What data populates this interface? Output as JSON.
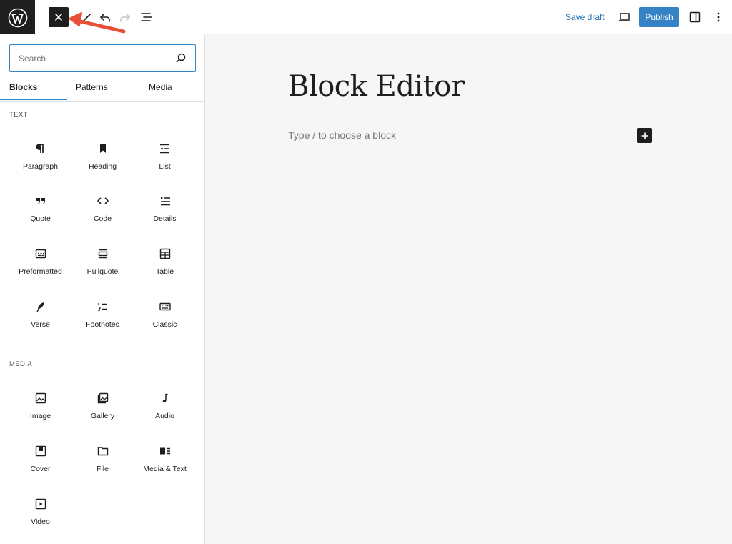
{
  "header": {
    "save_draft_label": "Save draft",
    "publish_label": "Publish",
    "icons": [
      "wordpress-logo-icon",
      "close-icon",
      "undo-icon",
      "redo-icon",
      "document-overview-icon",
      "preview-icon",
      "settings-icon",
      "more-options-icon"
    ]
  },
  "inserter": {
    "search_placeholder": "Search",
    "tabs": [
      "Blocks",
      "Patterns",
      "Media"
    ],
    "active_tab": "Blocks",
    "sections": [
      {
        "label": "TEXT",
        "blocks": [
          {
            "label": "Paragraph",
            "icon": "paragraph-icon"
          },
          {
            "label": "Heading",
            "icon": "heading-icon"
          },
          {
            "label": "List",
            "icon": "list-icon"
          },
          {
            "label": "Quote",
            "icon": "quote-icon"
          },
          {
            "label": "Code",
            "icon": "code-icon"
          },
          {
            "label": "Details",
            "icon": "details-icon"
          },
          {
            "label": "Preformatted",
            "icon": "preformatted-icon"
          },
          {
            "label": "Pullquote",
            "icon": "pullquote-icon"
          },
          {
            "label": "Table",
            "icon": "table-icon"
          },
          {
            "label": "Verse",
            "icon": "verse-icon"
          },
          {
            "label": "Footnotes",
            "icon": "footnotes-icon"
          },
          {
            "label": "Classic",
            "icon": "classic-icon"
          }
        ]
      },
      {
        "label": "MEDIA",
        "blocks": [
          {
            "label": "Image",
            "icon": "image-icon"
          },
          {
            "label": "Gallery",
            "icon": "gallery-icon"
          },
          {
            "label": "Audio",
            "icon": "audio-icon"
          },
          {
            "label": "Cover",
            "icon": "cover-icon"
          },
          {
            "label": "File",
            "icon": "file-icon"
          },
          {
            "label": "Media & Text",
            "icon": "media-text-icon"
          },
          {
            "label": "Video",
            "icon": "video-icon"
          }
        ]
      }
    ]
  },
  "editor": {
    "title": "Block Editor",
    "placeholder": "Type / to choose a block"
  },
  "colors": {
    "accent": "#3582c4",
    "dark": "#1e1e1e",
    "annotation_arrow": "#e8503a"
  }
}
